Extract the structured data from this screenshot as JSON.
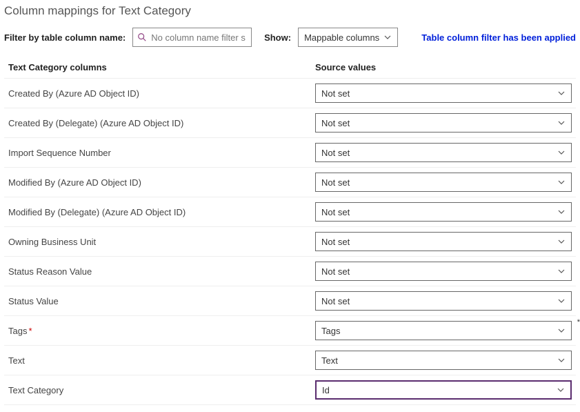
{
  "title": "Column mappings for Text Category",
  "filter": {
    "label": "Filter by table column name:",
    "placeholder": "No column name filter sp..."
  },
  "show": {
    "label": "Show:",
    "value": "Mappable columns"
  },
  "filter_applied_msg": "Table column filter has been applied",
  "headers": {
    "left": "Text Category columns",
    "right": "Source values"
  },
  "rows": [
    {
      "label": "Created By (Azure AD Object ID)",
      "value": "Not set",
      "required": false,
      "highlight": false
    },
    {
      "label": "Created By (Delegate) (Azure AD Object ID)",
      "value": "Not set",
      "required": false,
      "highlight": false
    },
    {
      "label": "Import Sequence Number",
      "value": "Not set",
      "required": false,
      "highlight": false
    },
    {
      "label": "Modified By (Azure AD Object ID)",
      "value": "Not set",
      "required": false,
      "highlight": false
    },
    {
      "label": "Modified By (Delegate) (Azure AD Object ID)",
      "value": "Not set",
      "required": false,
      "highlight": false
    },
    {
      "label": "Owning Business Unit",
      "value": "Not set",
      "required": false,
      "highlight": false
    },
    {
      "label": "Status Reason Value",
      "value": "Not set",
      "required": false,
      "highlight": false
    },
    {
      "label": "Status Value",
      "value": "Not set",
      "required": false,
      "highlight": false
    },
    {
      "label": "Tags",
      "value": "Tags",
      "required": true,
      "highlight": false,
      "trailing_mark": "*"
    },
    {
      "label": "Text",
      "value": "Text",
      "required": false,
      "highlight": false
    },
    {
      "label": "Text Category",
      "value": "Id",
      "required": false,
      "highlight": true
    }
  ]
}
